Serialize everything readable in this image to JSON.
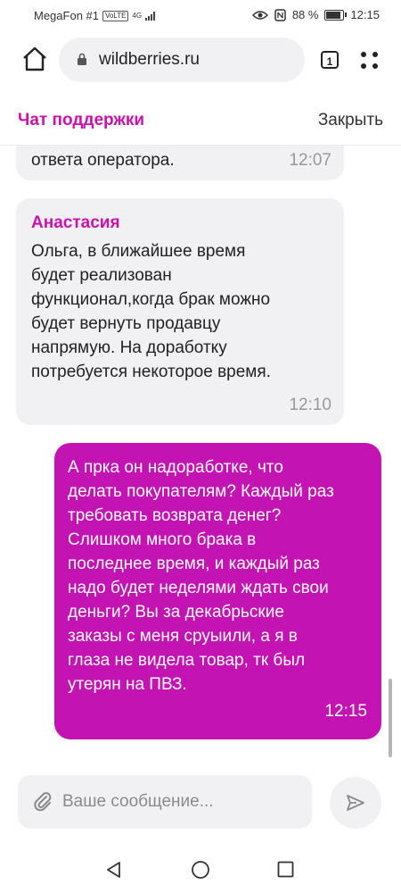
{
  "status_bar": {
    "carrier": "MegaFon #1",
    "volte": "VoLTE",
    "network": "4G",
    "battery": "88 %",
    "time": "12:15"
  },
  "browser": {
    "url": "wildberries.ru",
    "tab_count": "1"
  },
  "chat": {
    "title": "Чат поддержки",
    "close_label": "Закрыть"
  },
  "messages": [
    {
      "direction": "incoming",
      "sender": "",
      "text": "ответа оператора.",
      "time": "12:07"
    },
    {
      "direction": "incoming",
      "sender": "Анастасия",
      "text": "Ольга, в ближайшее время будет реализован функционал,когда брак можно будет вернуть продавцу напрямую. На доработку потребуется некоторое время.",
      "time": "12:10"
    },
    {
      "direction": "outgoing",
      "sender": "",
      "text": "А прка он надоработке, что делать покупателям? Каждый раз требовать возврата денег? Слишком много брака в последнее время, и каждый раз надо будет неделями ждать свои деньги? Вы за декабрьские заказы с меня сруыили, а я в глаза не видела товар, тк был утерян на ПВЗ.",
      "time": "12:15"
    }
  ],
  "composer": {
    "placeholder": "Ваше сообщение..."
  },
  "colors": {
    "accent": "#cb11ab",
    "outgoing_bubble": "#c413b3",
    "incoming_bubble": "#f1f1f4"
  },
  "icons": [
    "home-icon",
    "lock-icon",
    "tabs-icon",
    "menu-dots-icon",
    "paperclip-icon",
    "send-icon",
    "back-nav-icon",
    "home-nav-icon",
    "recents-nav-icon"
  ]
}
